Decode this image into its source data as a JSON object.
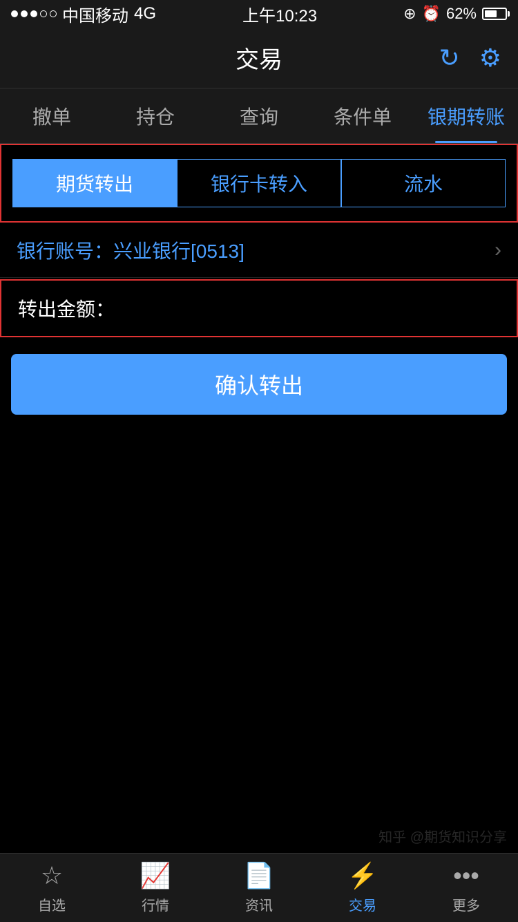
{
  "statusBar": {
    "carrier": "中国移动",
    "network": "4G",
    "time": "上午10:23",
    "battery": "62%"
  },
  "header": {
    "title": "交易",
    "refreshLabel": "↻",
    "settingsLabel": "⚙"
  },
  "topTabs": [
    {
      "label": "撤单",
      "active": false
    },
    {
      "label": "持仓",
      "active": false
    },
    {
      "label": "查询",
      "active": false
    },
    {
      "label": "条件单",
      "active": false
    },
    {
      "label": "银期转账",
      "active": true
    }
  ],
  "subTabs": [
    {
      "label": "期货转出",
      "active": true
    },
    {
      "label": "银行卡转入",
      "active": false
    },
    {
      "label": "流水",
      "active": false
    }
  ],
  "bankAccount": {
    "prefix": "银行账号：兴业银行",
    "highlight": "[0513]"
  },
  "transferAmount": {
    "label": "转出金额：",
    "placeholder": ""
  },
  "confirmButton": {
    "label": "确认转出"
  },
  "bottomNav": [
    {
      "label": "自选",
      "icon": "☆",
      "active": false
    },
    {
      "label": "行情",
      "icon": "📈",
      "active": false
    },
    {
      "label": "资讯",
      "icon": "📄",
      "active": false
    },
    {
      "label": "交易",
      "icon": "⚡",
      "active": true
    },
    {
      "label": "更多",
      "icon": "•••",
      "active": false
    }
  ],
  "watermark": "知乎 @期货知识分享"
}
